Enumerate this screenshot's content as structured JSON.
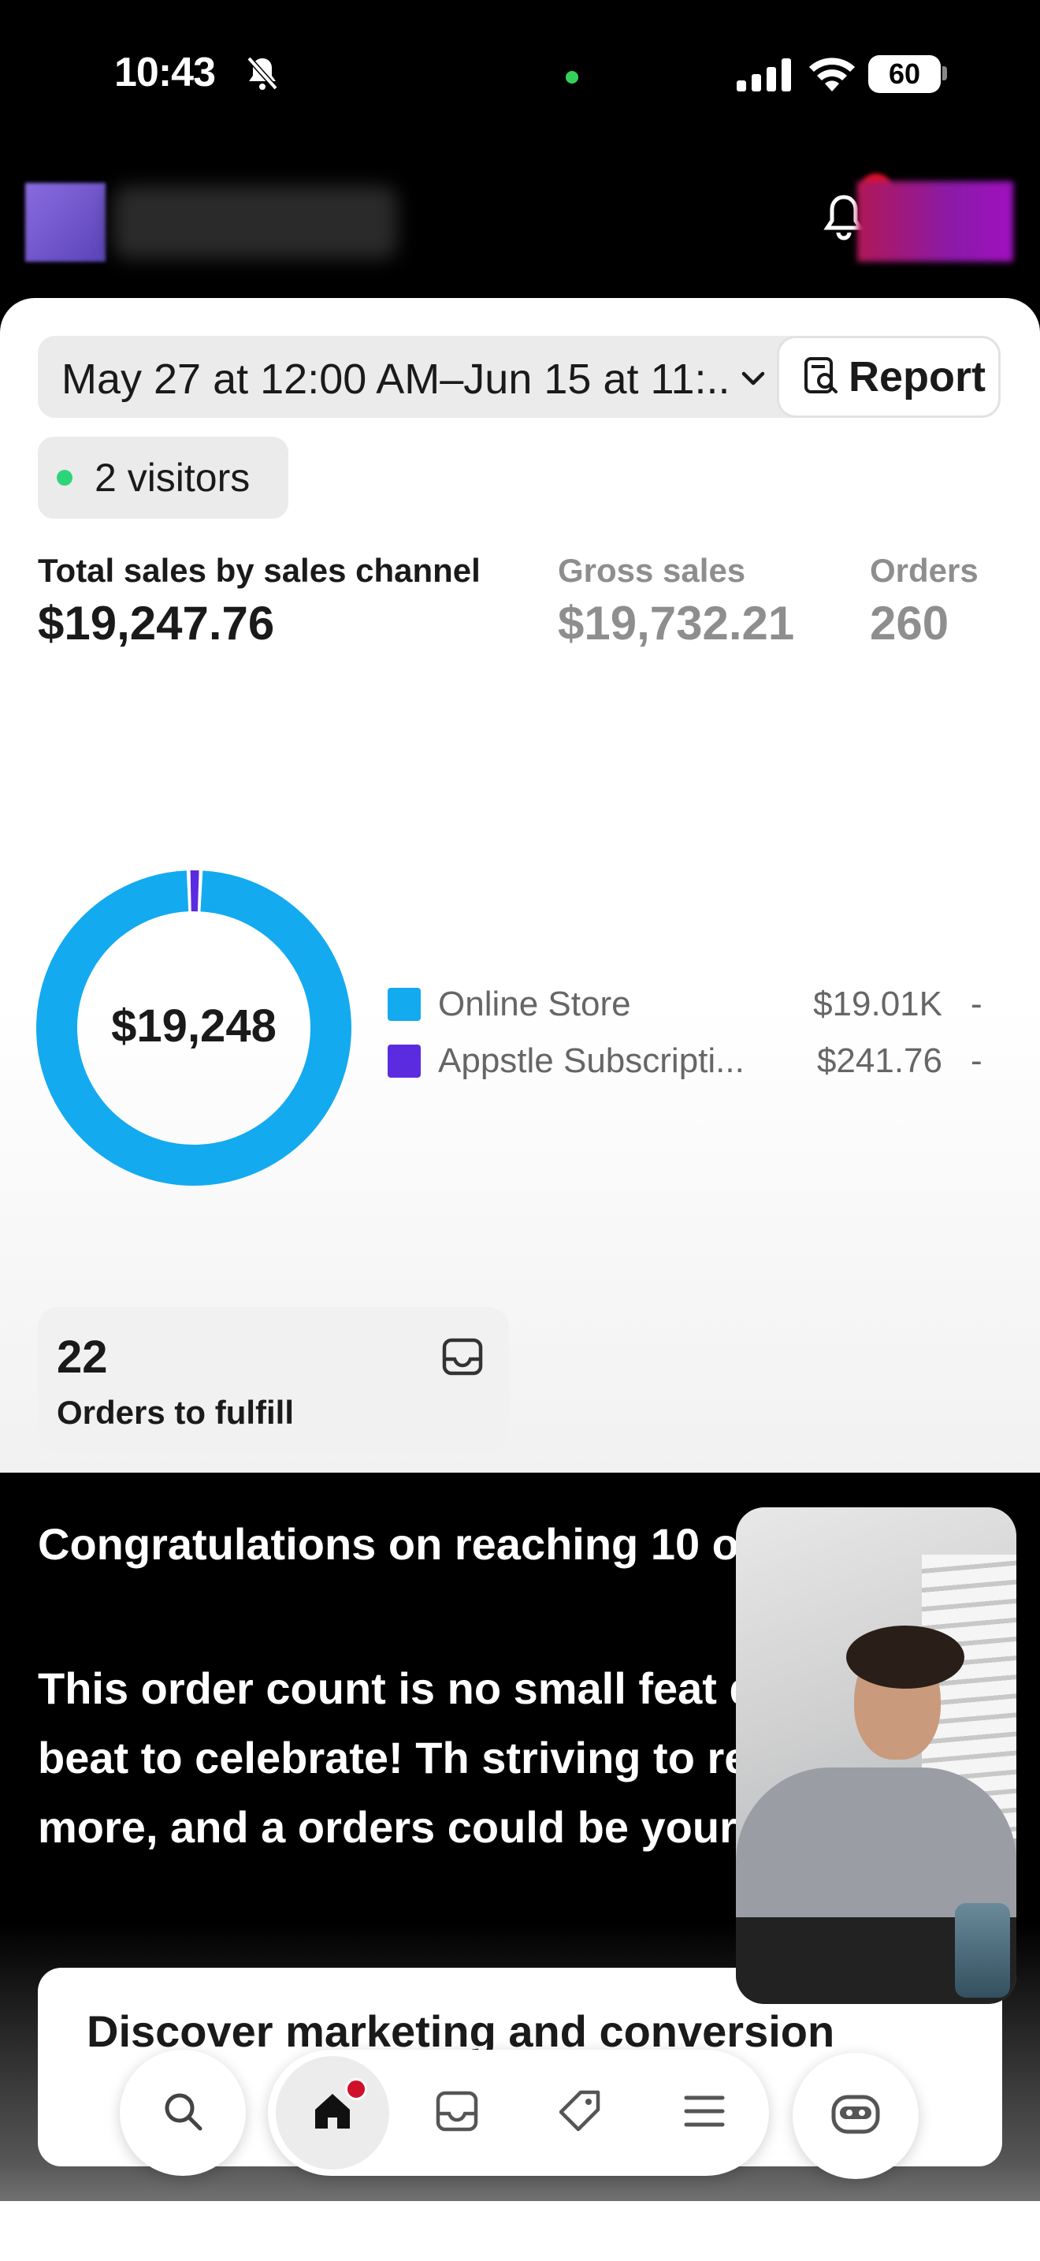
{
  "status_bar": {
    "time": "10:43",
    "battery": "60"
  },
  "header": {
    "notifications_icon": "bell-icon"
  },
  "filters": {
    "date_range": "May 27 at 12:00 AM–Jun 15 at 11:...",
    "report_label": "Report",
    "visitors_label": "2 visitors"
  },
  "metrics": [
    {
      "label": "Total sales by sales channel",
      "value": "$19,247.76"
    },
    {
      "label": "Gross sales",
      "value": "$19,732.21"
    },
    {
      "label": "Orders",
      "value": "260"
    }
  ],
  "chart_data": {
    "type": "pie",
    "center_label": "$19,248",
    "categories": [
      "Online Store",
      "Appstle Subscripti..."
    ],
    "values": [
      19006.0,
      241.76
    ],
    "value_labels": [
      "$19.01K",
      "$241.76"
    ],
    "change_labels": [
      "-",
      "-"
    ],
    "colors": [
      "#13aaf0",
      "#5b2be0"
    ],
    "legend": "right"
  },
  "fulfill": {
    "count": "22",
    "label": "Orders to fulfill"
  },
  "announcement": {
    "title": "Congratulations on reaching 10 orders!",
    "body": "This order count is no small feat deserves a beat to celebrate! Th striving to reach 10x more, and a orders could be yours."
  },
  "discover_card": {
    "title": "Discover marketing and conversion"
  },
  "bottom_nav": {
    "items": [
      "search-icon",
      "home-icon",
      "inbox-icon",
      "tag-icon",
      "menu-icon",
      "assistant-icon"
    ]
  }
}
